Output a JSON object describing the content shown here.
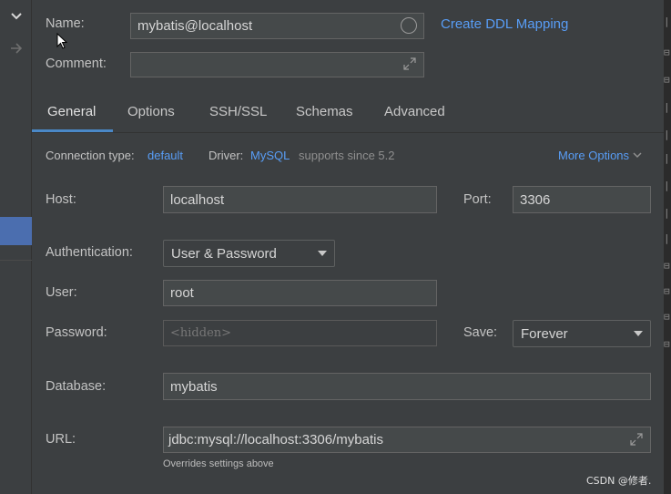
{
  "header": {
    "name_label": "Name:",
    "name_value": "mybatis@localhost",
    "ddl_link": "Create DDL Mapping",
    "comment_label": "Comment:",
    "comment_value": ""
  },
  "tabs": [
    {
      "label": "General",
      "active": true
    },
    {
      "label": "Options",
      "active": false
    },
    {
      "label": "SSH/SSL",
      "active": false
    },
    {
      "label": "Schemas",
      "active": false
    },
    {
      "label": "Advanced",
      "active": false
    }
  ],
  "connection": {
    "type_label": "Connection type:",
    "type_value": "default",
    "driver_label": "Driver:",
    "driver_value": "MySQL",
    "driver_note": "supports since 5.2",
    "more_options": "More Options"
  },
  "form": {
    "host_label": "Host:",
    "host_value": "localhost",
    "port_label": "Port:",
    "port_value": "3306",
    "auth_label": "Authentication:",
    "auth_value": "User & Password",
    "user_label": "User:",
    "user_value": "root",
    "password_label": "Password:",
    "password_placeholder": "<hidden>",
    "save_label": "Save:",
    "save_value": "Forever",
    "database_label": "Database:",
    "database_value": "mybatis",
    "url_label": "URL:",
    "url_value": "jdbc:mysql://localhost:3306/mybatis",
    "url_hint": "Overrides settings above"
  },
  "sidebar": {
    "chevron_icon": "chevron-down-icon",
    "arrow_icon": "arrow-right-icon"
  },
  "watermark": "CSDN @修者.",
  "colors": {
    "background": "#3c3f41",
    "field": "#45494a",
    "link": "#589df6",
    "selection": "#4b6eaf",
    "tab_underline": "#4a88c7"
  }
}
